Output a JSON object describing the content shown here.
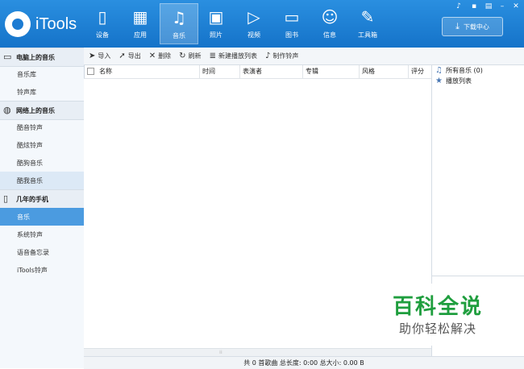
{
  "app": {
    "name": "iTools"
  },
  "nav": [
    {
      "label": "设备",
      "icon": "phone-icon"
    },
    {
      "label": "应用",
      "icon": "apps-icon"
    },
    {
      "label": "音乐",
      "icon": "music-icon",
      "active": true
    },
    {
      "label": "照片",
      "icon": "photo-icon"
    },
    {
      "label": "视频",
      "icon": "video-icon"
    },
    {
      "label": "图书",
      "icon": "book-icon"
    },
    {
      "label": "信息",
      "icon": "person-icon"
    },
    {
      "label": "工具箱",
      "icon": "wrench-icon"
    }
  ],
  "window_controls": [
    "music-note-icon",
    "feedback-icon",
    "menu-icon",
    "minimize-icon",
    "close-icon"
  ],
  "download_center": {
    "label": "下载中心",
    "icon": "download-icon"
  },
  "sidebar": {
    "sections": [
      {
        "title": "电脑上的音乐",
        "icon": "monitor-icon",
        "items": [
          {
            "label": "音乐库"
          },
          {
            "label": "铃声库"
          }
        ]
      },
      {
        "title": "网络上的音乐",
        "icon": "globe-icon",
        "items": [
          {
            "label": "酷音铃声"
          },
          {
            "label": "酷炫铃声"
          },
          {
            "label": "酷狗音乐"
          },
          {
            "label": "酷我音乐",
            "state": "hover"
          }
        ]
      },
      {
        "title": "几年的手机",
        "icon": "device-icon",
        "items": [
          {
            "label": "音乐",
            "state": "selected"
          },
          {
            "label": "系统铃声"
          },
          {
            "label": "语音备忘录"
          },
          {
            "label": "iTools铃声"
          }
        ]
      }
    ]
  },
  "toolbar": {
    "import": "导入",
    "export": "导出",
    "delete": "删除",
    "refresh": "刷新",
    "new_playlist": "新建播放列表",
    "make_ringtone": "制作铃声"
  },
  "table": {
    "columns": [
      "名称",
      "时间",
      "表演者",
      "专辑",
      "风格",
      "评分"
    ]
  },
  "right_panel": {
    "all_music": "所有音乐 (0)",
    "playlist": "播放列表"
  },
  "status": "共 0 首歌曲   总长度: 0:00   总大小: 0.00 B",
  "watermark": {
    "title": "百科全说",
    "subtitle": "助你轻松解决"
  },
  "colors": {
    "header": "#1f80d6",
    "selected": "#4b9be0",
    "watermark": "#1f9e3e"
  }
}
